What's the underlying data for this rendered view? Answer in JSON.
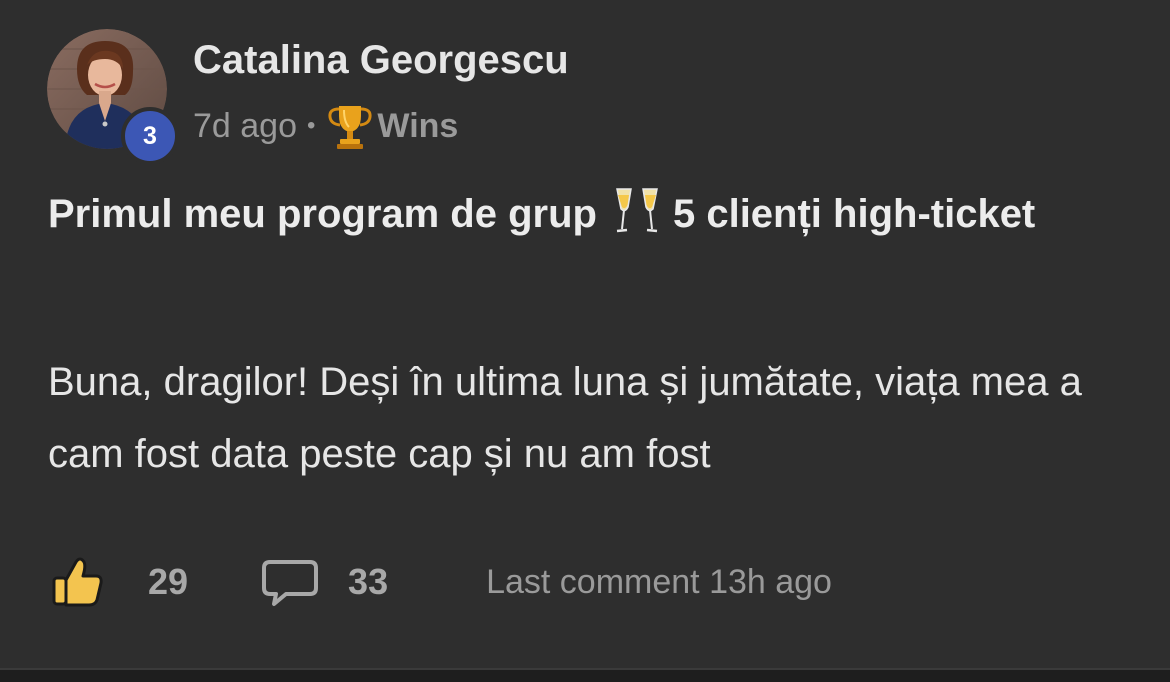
{
  "post": {
    "author": {
      "name": "Catalina Georgescu",
      "level": "3",
      "avatar_icon": "profile-photo"
    },
    "meta": {
      "time_ago": "7d ago",
      "separator": "•",
      "category_icon": "trophy-icon",
      "category": "Wins"
    },
    "title": {
      "part1": "Primul meu program de grup",
      "emoji_icon": "champagne-glasses-icon",
      "part2": "5 clienți high-ticket"
    },
    "body": "Buna, dragilor! Deși în ultima luna și jumătate, viața mea a cam fost data peste cap și nu am fost",
    "footer": {
      "like_icon": "thumbs-up-icon",
      "likes": "29",
      "comment_icon": "comment-icon",
      "comments": "33",
      "last_comment": "Last comment 13h ago"
    }
  },
  "colors": {
    "background": "#2e2e2e",
    "primary_text": "#e6e6e6",
    "secondary_text": "#9a9a9a",
    "level_badge": "#3c57b5",
    "like_icon_fill": "#f3c44f"
  }
}
